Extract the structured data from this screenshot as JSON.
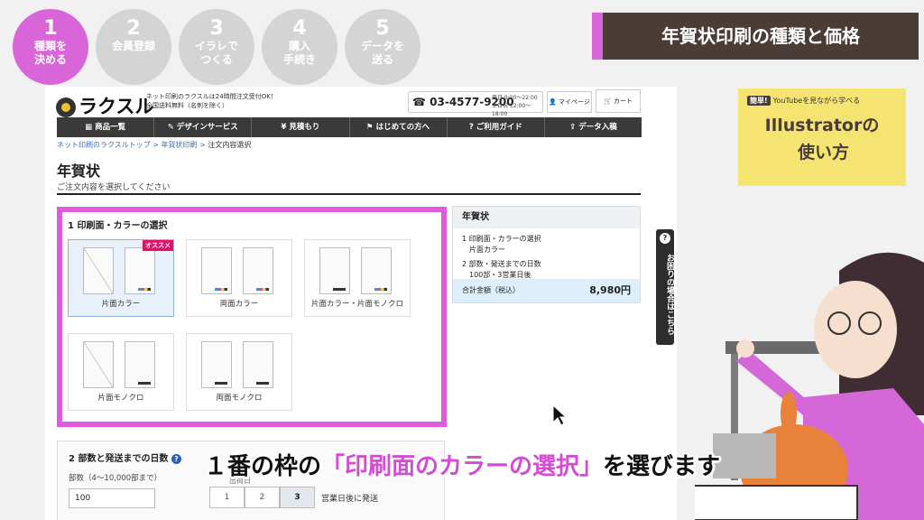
{
  "steps": [
    {
      "num": "1",
      "label1": "種類を",
      "label2": "決める"
    },
    {
      "num": "2",
      "label1": "会員登録",
      "label2": ""
    },
    {
      "num": "3",
      "label1": "イラレで",
      "label2": "つくる"
    },
    {
      "num": "4",
      "label1": "購入",
      "label2": "手続き"
    },
    {
      "num": "5",
      "label1": "データを",
      "label2": "送る"
    }
  ],
  "banner_title": "年賀状印刷の種類と価格",
  "site": {
    "logo_text": "ラクスル",
    "tagline1": "ネット印刷のラクスルは24時間注文受付OK！",
    "tagline2": "全国送料無料（名刺を除く）",
    "phone": "03-4577-9200",
    "phone_hours1": "平日 9:00〜22:00",
    "phone_hours2": "土日祝 12:00〜18:00",
    "mypage": "マイページ",
    "cart": "カート",
    "nav": [
      "商品一覧",
      "デザインサービス",
      "見積もり",
      "はじめての方へ",
      "ご利用ガイド",
      "データ入稿"
    ],
    "breadcrumb": [
      "ネット印刷のラクスルトップ",
      "年賀状印刷",
      "注文内容選択"
    ],
    "page_title": "年賀状",
    "page_subtitle": "ご注文内容を選択してください",
    "section1_title": "1 印刷面・カラーの選択",
    "recommend": "オススメ",
    "options": [
      "片面カラー",
      "両面カラー",
      "片面カラー・片面モノクロ",
      "片面モノクロ",
      "両面モノクロ"
    ],
    "summary": {
      "title": "年賀状",
      "item1_label": "1 印刷面・カラーの選択",
      "item1_value": "片面カラー",
      "item2_label": "2 部数・発送までの日数",
      "item2_value": "100部・3営業日後",
      "total_label": "合計金額（税込）",
      "total_value": "8,980円"
    },
    "help_text": "お困りの場合はこちら",
    "section2_title": "2 部数と発送までの日数",
    "quantity_label": "部数（4〜10,000部まで）",
    "quantity_value": "100",
    "days_caption": "出荷日",
    "days": [
      "1",
      "2",
      "3"
    ],
    "days_suffix": "営業日後に発送"
  },
  "thumbnail": {
    "badge": "簡単!",
    "line1": "YouTubeを見ながら学べる",
    "line2": "Illustratorの",
    "line3": "使い方"
  },
  "caption": {
    "pre": "１番の枠の",
    "highlight": "「印刷面のカラーの選択」",
    "post": "を選びます"
  },
  "colors": {
    "accent": "#d966d9",
    "highlight_border": "#e05ae0",
    "banner": "#4a3c36"
  }
}
